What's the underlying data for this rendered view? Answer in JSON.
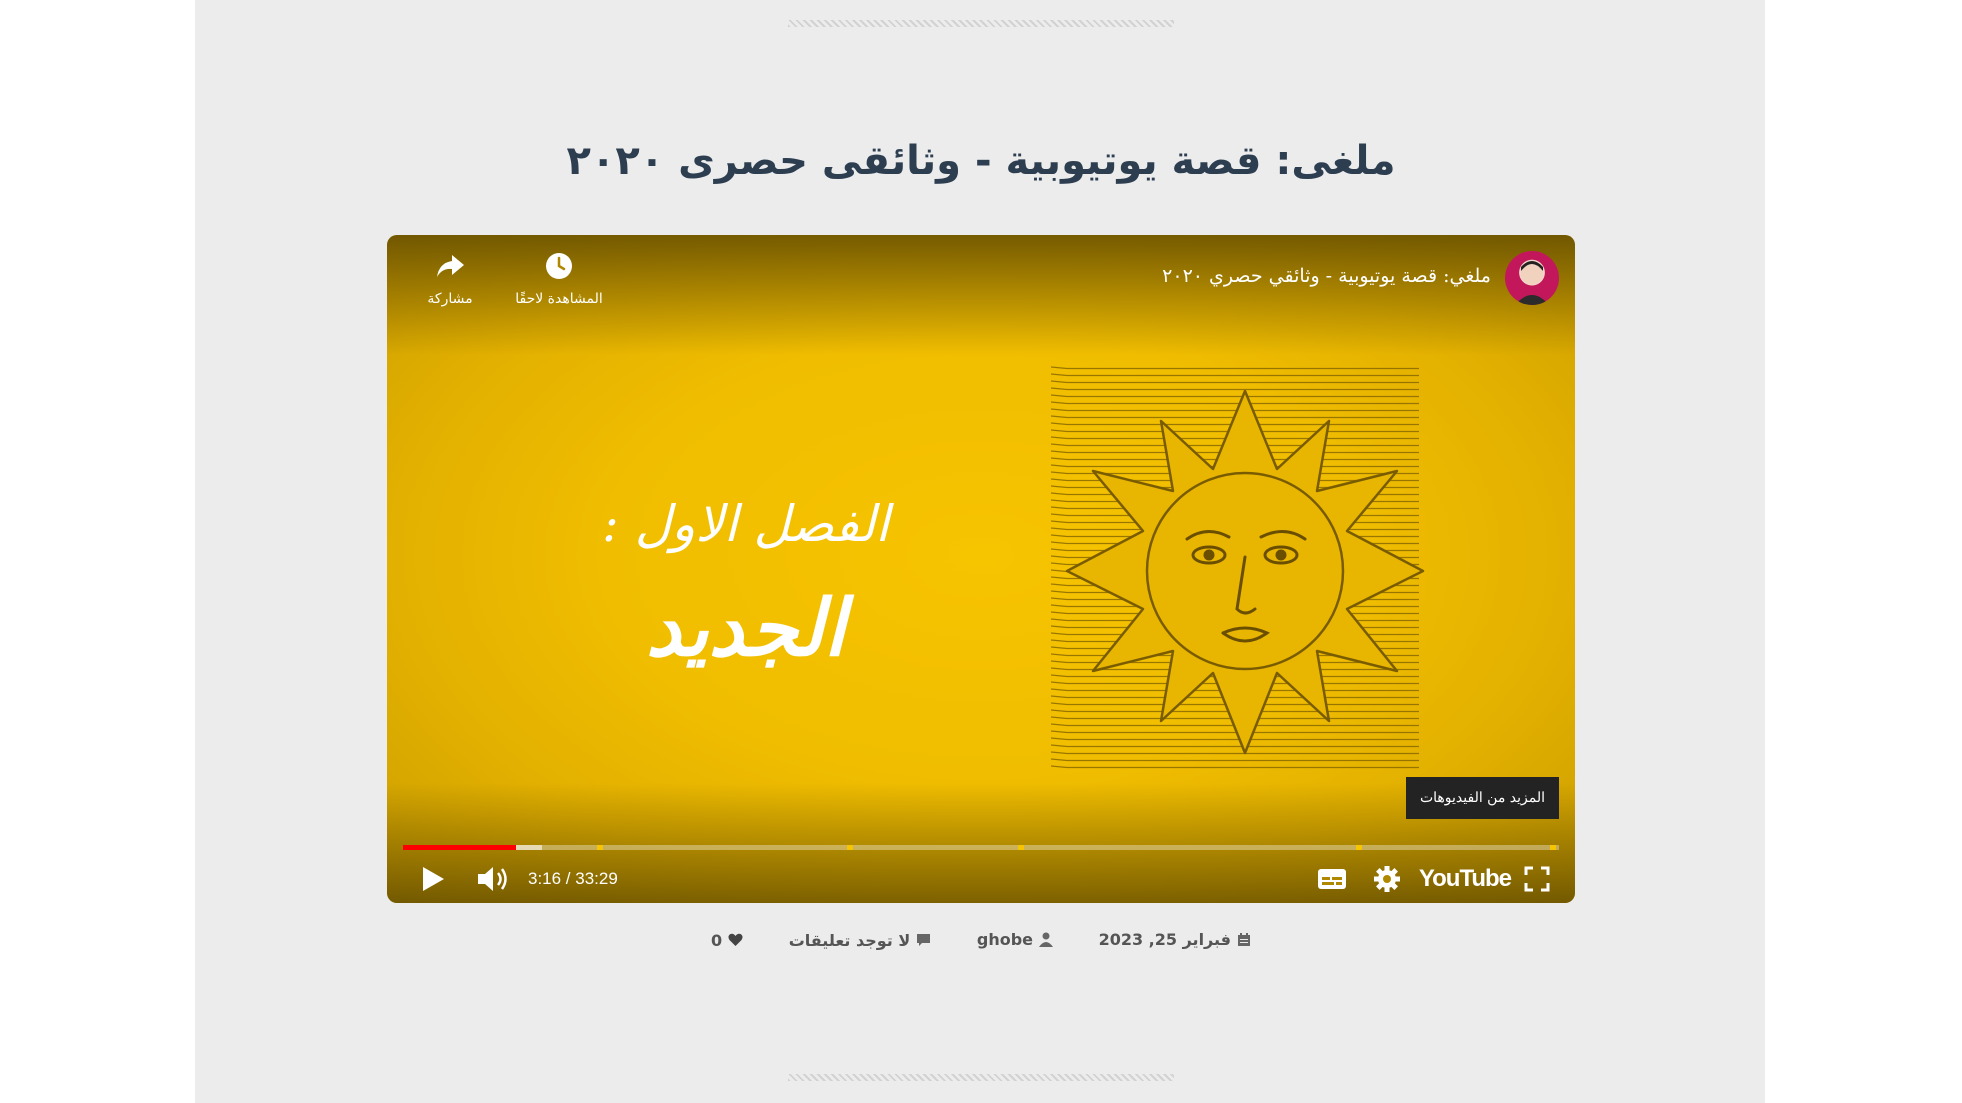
{
  "post": {
    "title": "ملغى: قصة يوتيوبية - وثائقى حصرى ٢٠٢٠"
  },
  "player": {
    "video_title": "ملغي: قصة يوتيوبية - وثائقي حصري ٢٠٢٠",
    "watch_later_label": "المشاهدة لاحقًا",
    "share_label": "مشاركة",
    "chapter_label": "الفصل الاول :",
    "chapter_name": "الجديد",
    "more_videos_label": "المزيد من الفيديوهات",
    "current_time": "3:16",
    "duration": "33:29",
    "time_display": "3:16 / 33:29",
    "progress_fraction": 0.0976,
    "buffer_fraction": 0.12,
    "chapter_marks_fractions": [
      0.17,
      0.387,
      0.535,
      0.827,
      0.995
    ],
    "brand_label": "YouTube",
    "accent_color": "#ff0000",
    "background_color": "#f7c400"
  },
  "meta": {
    "likes": "0",
    "comments": "لا توجد تعليقات",
    "author": "ghobe",
    "date": "فبراير 25, 2023"
  },
  "icons": {
    "share": "share-arrow-icon",
    "watch_later": "clock-icon",
    "play": "play-icon",
    "volume": "volume-icon",
    "subtitles": "subtitles-icon",
    "settings": "gear-icon",
    "fullscreen": "fullscreen-icon",
    "heart": "heart-icon",
    "comment": "comment-icon",
    "user": "user-icon",
    "calendar": "calendar-icon"
  }
}
